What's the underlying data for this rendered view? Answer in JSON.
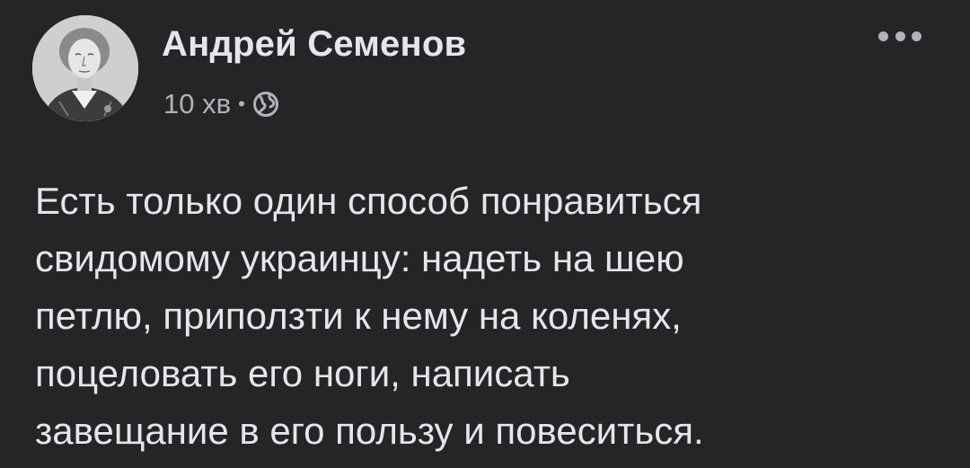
{
  "post": {
    "author": "Андрей Семенов",
    "time": "10 хв",
    "separator": "•",
    "privacy_icon": "globe-icon",
    "menu_icon": "more-horizontal-icon",
    "text_lines": [
      "Есть только один способ понравиться",
      "свидомому украинцу: надеть на шею",
      "петлю, приползти к нему на коленях,",
      "поцеловать его ноги, написать",
      "завещание в его пользу и повеситься."
    ]
  },
  "colors": {
    "background": "#242526",
    "primary_text": "#e4e6eb",
    "secondary_text": "#b0b3b8"
  }
}
